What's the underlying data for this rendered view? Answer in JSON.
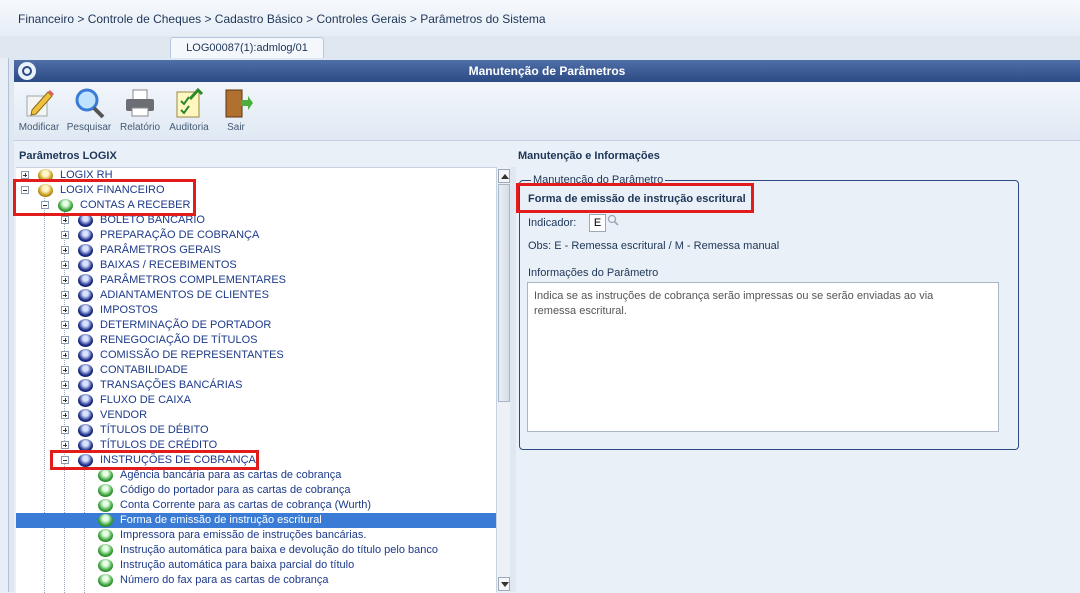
{
  "breadcrumb": "Financeiro > Controle de Cheques > Cadastro Básico > Controles Gerais > Parâmetros do Sistema",
  "tab_label": "LOG00087(1):admlog/01",
  "window_title": "Manutenção de Parâmetros",
  "toolbar": {
    "modificar": "Modificar",
    "pesquisar": "Pesquisar",
    "relatorio": "Relatório",
    "auditoria": "Auditoria",
    "sair": "Sair"
  },
  "left_panel_title": "Parâmetros LOGIX",
  "right_panel_title": "Manutenção e Informações",
  "tree": {
    "logix_rh": "LOGIX RH",
    "logix_financeiro": "LOGIX FINANCEIRO",
    "contas_a_receber": "CONTAS A RECEBER",
    "groups": [
      "BOLETO BANCÁRIO",
      "PREPARAÇÃO DE COBRANÇA",
      "PARÂMETROS GERAIS",
      "BAIXAS / RECEBIMENTOS",
      "PARÂMETROS COMPLEMENTARES",
      "ADIANTAMENTOS DE CLIENTES",
      "IMPOSTOS",
      "DETERMINAÇÃO DE PORTADOR",
      "RENEGOCIAÇÃO DE TÍTULOS",
      "COMISSÃO DE REPRESENTANTES",
      "CONTABILIDADE",
      "TRANSAÇÕES BANCÁRIAS",
      "FLUXO DE CAIXA",
      "VENDOR",
      "TÍTULOS DE DÉBITO",
      "TÍTULOS DE CRÉDITO"
    ],
    "instrucoes": "INSTRUÇÕES DE COBRANÇA",
    "children": [
      "Agência bancária para as cartas de cobrança",
      "Código do portador para as cartas de cobrança",
      "Conta Corrente para as cartas de cobrança (Wurth)",
      "Forma de emissão de instrução escritural",
      "Impressora para emissão de instruções bancárias.",
      "Instrução automática para baixa e devolução do título pelo banco",
      "Instrução automática para baixa parcial do título",
      "Número do fax para as cartas de cobrança"
    ]
  },
  "param": {
    "legend": "Manutenção do Parâmetro",
    "title": "Forma de emissão de instrução escritural",
    "indicador_label": "Indicador:",
    "indicador_value": "E",
    "obs": "Obs: E - Remessa escritural / M - Remessa manual",
    "info_label": "Informações do Parâmetro",
    "info_text": "Indica se as instruções de cobrança serão impressas ou se serão enviadas ao via remessa escritural."
  }
}
